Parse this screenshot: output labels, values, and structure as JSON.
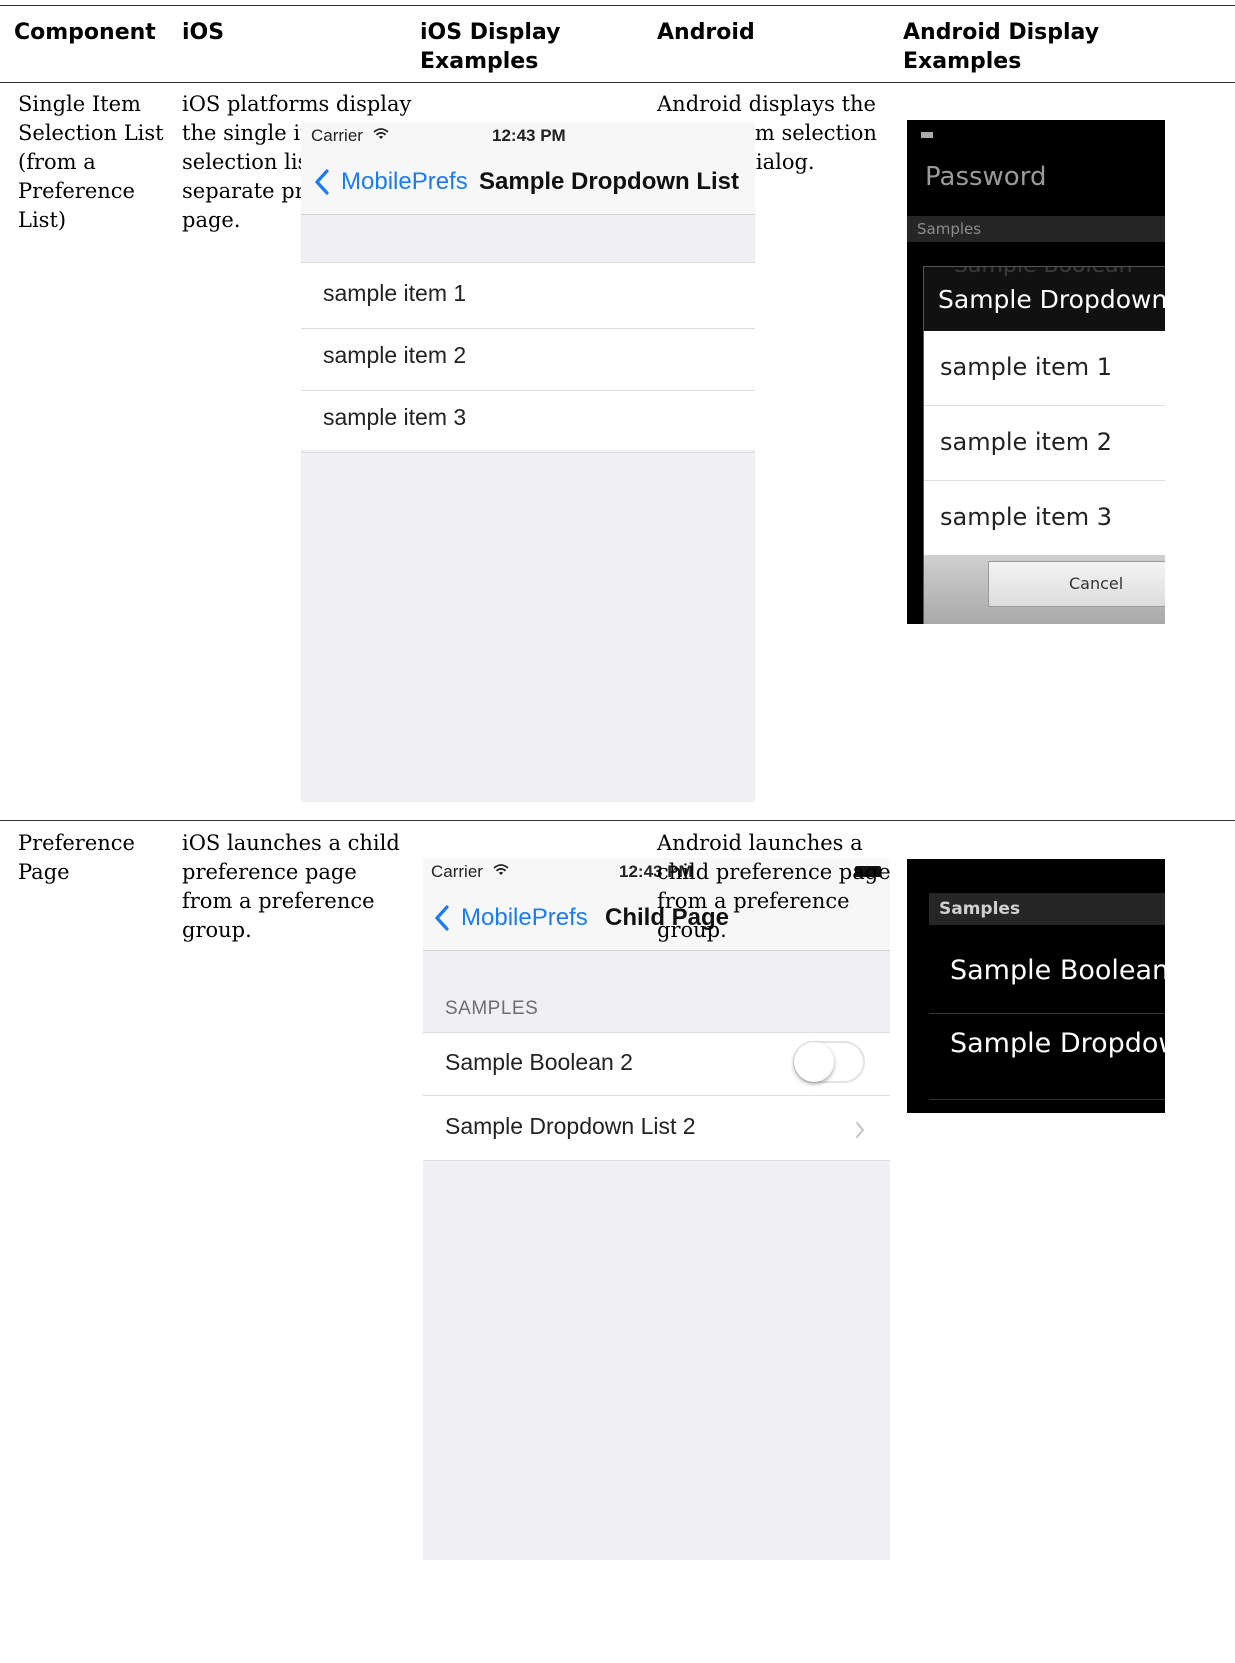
{
  "table": {
    "headers": [
      "Component",
      "iOS",
      "iOS Display Examples",
      "Android",
      "Android Display Examples"
    ],
    "rows": [
      {
        "component": "Single Item Selection List (from a Preference List)",
        "ios_text": "iOS platforms display the single item selection list on a separate preference page.",
        "android_text": "Android displays the single item selection list in a dialog."
      },
      {
        "component": "Preference Page",
        "ios_text": "iOS launches a child preference page from a preference group.",
        "android_text": "Android launches a child preference page from a preference group."
      }
    ]
  },
  "ios1": {
    "carrier": "Carrier",
    "time": "12:43 PM",
    "back_label": "MobilePrefs",
    "title": "Sample Dropdown List",
    "items": [
      "sample item 1",
      "sample item 2",
      "sample item 3"
    ]
  },
  "android1": {
    "header": "Password",
    "section": "Samples",
    "behind_text": "Sample Boolean",
    "dialog_title": "Sample Dropdown List",
    "items": [
      "sample item 1",
      "sample item 2",
      "sample item 3"
    ],
    "cancel": "Cancel"
  },
  "ios2": {
    "carrier": "Carrier",
    "time": "12:43 PM",
    "back_label": "MobilePrefs",
    "title": "Child Page",
    "section": "SAMPLES",
    "toggle_label": "Sample Boolean 2",
    "toggle_on": false,
    "dropdown_label": "Sample Dropdown List 2"
  },
  "android2": {
    "section": "Samples",
    "items": [
      "Sample Boolean",
      "Sample Dropdown List"
    ]
  },
  "colors": {
    "ios_blue": "#1a7cf5",
    "ios_background": "#efeff4",
    "android_dialog_title": "#111111"
  }
}
